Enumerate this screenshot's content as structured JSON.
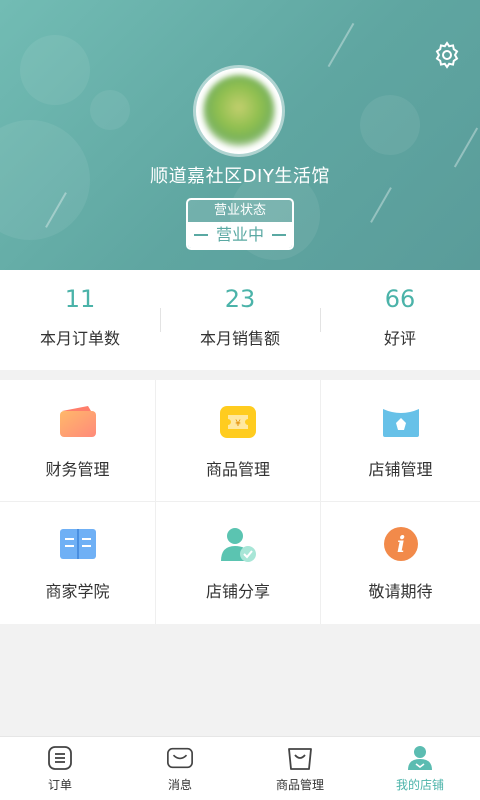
{
  "colors": {
    "accent": "#4bb3a9",
    "header": "#66aca8"
  },
  "header": {
    "store_name": "顺道嘉社区DIY生活馆",
    "status_label": "营业状态",
    "status_value": "营业中",
    "settings_icon": "gear-icon"
  },
  "stats": [
    {
      "value": "11",
      "label": "本月订单数"
    },
    {
      "value": "23",
      "label": "本月销售额"
    },
    {
      "value": "66",
      "label": "好评"
    }
  ],
  "grid": [
    {
      "label": "财务管理",
      "icon": "wallet-icon"
    },
    {
      "label": "商品管理",
      "icon": "coupon-icon"
    },
    {
      "label": "店铺管理",
      "icon": "store-icon"
    },
    {
      "label": "商家学院",
      "icon": "book-icon"
    },
    {
      "label": "店铺分享",
      "icon": "user-share-icon"
    },
    {
      "label": "敬请期待",
      "icon": "info-icon"
    }
  ],
  "tabbar": [
    {
      "label": "订单",
      "icon": "order-icon",
      "active": false
    },
    {
      "label": "消息",
      "icon": "message-icon",
      "active": false
    },
    {
      "label": "商品管理",
      "icon": "bag-icon",
      "active": false
    },
    {
      "label": "我的店铺",
      "icon": "my-store-icon",
      "active": true
    }
  ]
}
